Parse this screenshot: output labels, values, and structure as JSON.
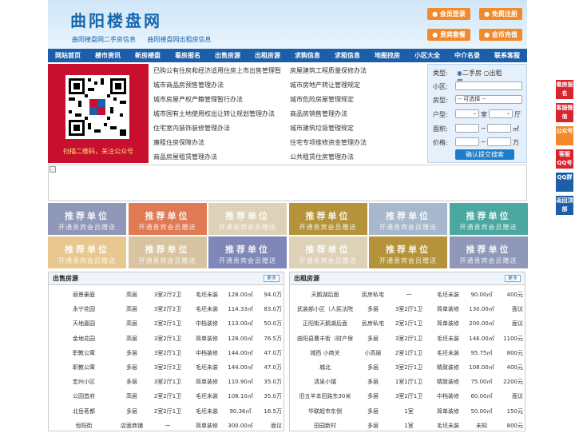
{
  "site": {
    "title": "曲阳楼盘网",
    "sublink_1": "曲阳楼盘网二手房信息",
    "sublink_2": "曲阳楼盘网出租房信息"
  },
  "header_buttons": [
    "会员登录",
    "免费注册",
    "贵宾套餐",
    "金币充值"
  ],
  "nav": [
    "网站首页",
    "楼市资讯",
    "新房楼盘",
    "看房报名",
    "出售房源",
    "出租房源",
    "求购信息",
    "求租信息",
    "地图找房",
    "小区大全",
    "中介名录",
    "联系客服"
  ],
  "qr": {
    "caption": "扫描二维码，关注公众号"
  },
  "news_left": [
    "已购公有住房和经济适用住房上市出售管理暂",
    "城市商品房预售管理办法",
    "城市房屋产权产籍管理暂行办法",
    "城市国有土地使用权出让转让规划管理办法",
    "住宅室内装饰装修管理办法",
    "廉租住房保障办法",
    "商品房屋租赁管理办法"
  ],
  "news_right": [
    "房屋建筑工程质量保修办法",
    "城市房地产转让管理规定",
    "城市危险房屋管理规定",
    "商品房销售管理办法",
    "城市建筑垃圾管理规定",
    "住宅专项维修资金管理办法",
    "公共租赁住房管理办法"
  ],
  "search": {
    "type_label": "类型:",
    "radio_1": "二手房",
    "radio_2": "出租房",
    "community_label": "小区:",
    "housetype_label": "房型:",
    "housetype_value": "-- 可选择 --",
    "layout_label": "户型:",
    "room_unit": "室",
    "hall_unit": "厅",
    "area_label": "面积:",
    "area_unit": "㎡",
    "price_label": "价格:",
    "price_unit": "万",
    "submit": "确认提交搜索"
  },
  "tiles": {
    "line1": "推荐单位",
    "line2": "开通贵宾会员赠送",
    "colors": [
      "#8f98b8",
      "#e07a54",
      "#ddd2b8",
      "#b4933a",
      "#a8b8cc",
      "#4aa8a0",
      "#e8c890",
      "#d8c4a0",
      "#7f86b8",
      "#ddd2b8",
      "#b4933a",
      "#8f98b8"
    ]
  },
  "sale": {
    "title": "出售房源",
    "more": "更多",
    "rows": [
      [
        "丽景豪庭",
        "高层",
        "3室2厅2卫",
        "毛坯未装",
        "128.00㎡",
        "94.0万"
      ],
      [
        "永宁花园",
        "高层",
        "3室2厅2卫",
        "毛坯未装",
        "114.33㎡",
        "83.0万"
      ],
      [
        "天地嘉园",
        "高层",
        "2室2厅1卫",
        "中档装修",
        "113.00㎡",
        "50.0万"
      ],
      [
        "金地花园",
        "高层",
        "3室2厅1卫",
        "简单装修",
        "128.00㎡",
        "76.5万"
      ],
      [
        "职教公寓",
        "多层",
        "3室2厅1卫",
        "中档装修",
        "144.00㎡",
        "47.0万"
      ],
      [
        "职教公寓",
        "多层",
        "3室2厅2卫",
        "毛坯未装",
        "144.00㎡",
        "47.0万"
      ],
      [
        "宏州小区",
        "多层",
        "3室2厅1卫",
        "简单装修",
        "110.90㎡",
        "35.0万"
      ],
      [
        "公园首府",
        "高层",
        "2室2厅1卫",
        "毛坯未装",
        "108.10㎡",
        "35.0万"
      ],
      [
        "北岳茗都",
        "多层",
        "2室2厅1卫",
        "毛坯未装",
        "90.36㎡",
        "16.5万"
      ],
      [
        "恒阳街",
        "店面商铺",
        "一",
        "简单装修",
        "300.00㎡",
        "面议"
      ]
    ]
  },
  "rent": {
    "title": "出租房源",
    "more": "更多",
    "rows": [
      [
        "天鹅湖后面",
        "民房私宅",
        "一",
        "毛坯未装",
        "90.00㎡",
        "400元"
      ],
      [
        "武装部小区（人民法院",
        "多层",
        "3室2厅1卫",
        "简单装修",
        "130.00㎡",
        "面议"
      ],
      [
        "正阳街天鹅湖后面",
        "民房私宅",
        "2室1厅1卫",
        "简单装修",
        "200.00㎡",
        "面议"
      ],
      [
        "曲阳县曹丰街（财产保",
        "多层",
        "3室2厅1卫",
        "毛坯未装",
        "146.00㎡",
        "1100元"
      ],
      [
        "城西 小商关",
        "小高层",
        "2室1厅1卫",
        "毛坯未装",
        "95.75㎡",
        "800元"
      ],
      [
        "城北",
        "多层",
        "3室2厅1卫",
        "精致装修",
        "108.00㎡",
        "400元"
      ],
      [
        "清泉小镇",
        "多层",
        "1室1厅1卫",
        "精致装修",
        "75.00㎡",
        "2200元"
      ],
      [
        "旧五羊本田路东30米",
        "多层",
        "3室2厅1卫",
        "中档装修",
        "60.00㎡",
        "面议"
      ],
      [
        "华联超市东侧",
        "多层",
        "1室",
        "简单装修",
        "50.00㎡",
        "150元"
      ],
      [
        "田园新村",
        "多层",
        "1室",
        "毛坯未装",
        "未知",
        "800元"
      ]
    ]
  },
  "side_buttons": [
    {
      "text": "看房报名",
      "color": "#d9232d"
    },
    {
      "text": "客服微信",
      "color": "#d9232d"
    },
    {
      "text": "公众号",
      "color": "#f28a2c"
    },
    {
      "text": "客服QQ号",
      "color": "#d9232d"
    },
    {
      "text": "QQ群",
      "color": "#1d5ea8"
    },
    {
      "text": "返回顶部",
      "color": "#1d5ea8"
    }
  ]
}
